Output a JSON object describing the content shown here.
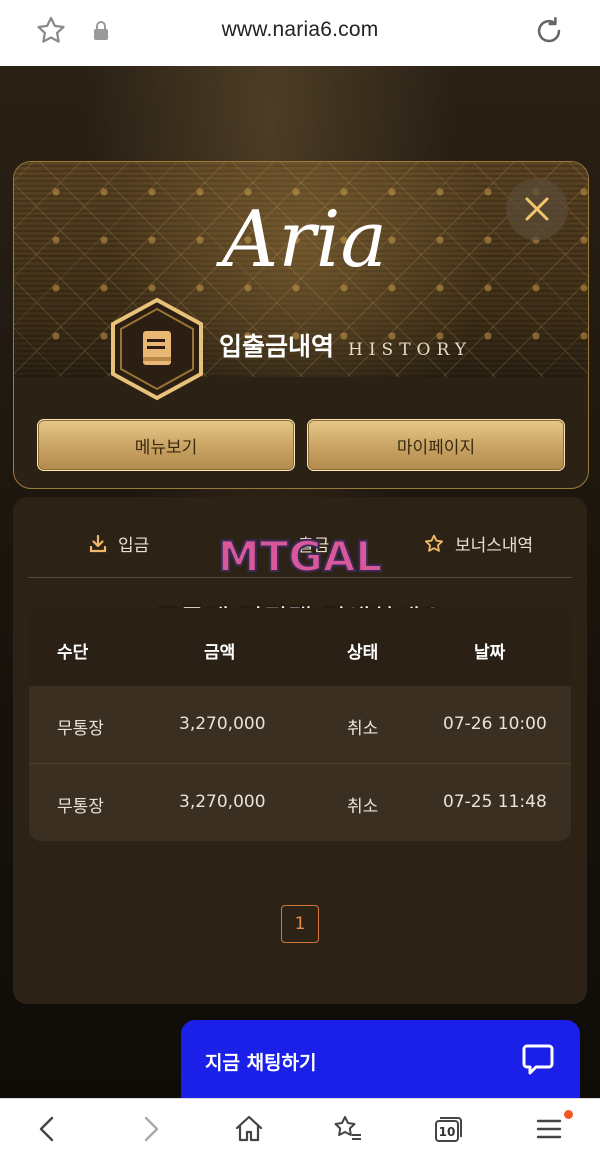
{
  "browser": {
    "url": "www.naria6.com"
  },
  "header": {
    "logo_text": "Aria",
    "title_ko": "입출금내역",
    "title_en": "HISTORY",
    "menu_button": "메뉴보기",
    "mypage_button": "마이페이지"
  },
  "tabs": {
    "deposit": "입금",
    "withdraw": "출금",
    "bonus": "보너스내역"
  },
  "watermark": {
    "logo": "MTGAL",
    "text": "구글에 먹튀갤 검색하세요"
  },
  "table": {
    "headers": {
      "method": "수단",
      "amount": "금액",
      "status": "상태",
      "date": "날짜"
    },
    "rows": [
      {
        "method": "무통장",
        "amount": "3,270,000",
        "status": "취소",
        "date": "07-26 10:00"
      },
      {
        "method": "무통장",
        "amount": "3,270,000",
        "status": "취소",
        "date": "07-25 11:48"
      }
    ]
  },
  "pagination": {
    "current": "1"
  },
  "chat": {
    "label": "지금 채팅하기"
  },
  "bottom_nav": {
    "tab_count": "10"
  },
  "colors": {
    "accent_gold": "#c8a262",
    "chat_blue": "#1a20e8",
    "pager_orange": "#e88d4a"
  }
}
